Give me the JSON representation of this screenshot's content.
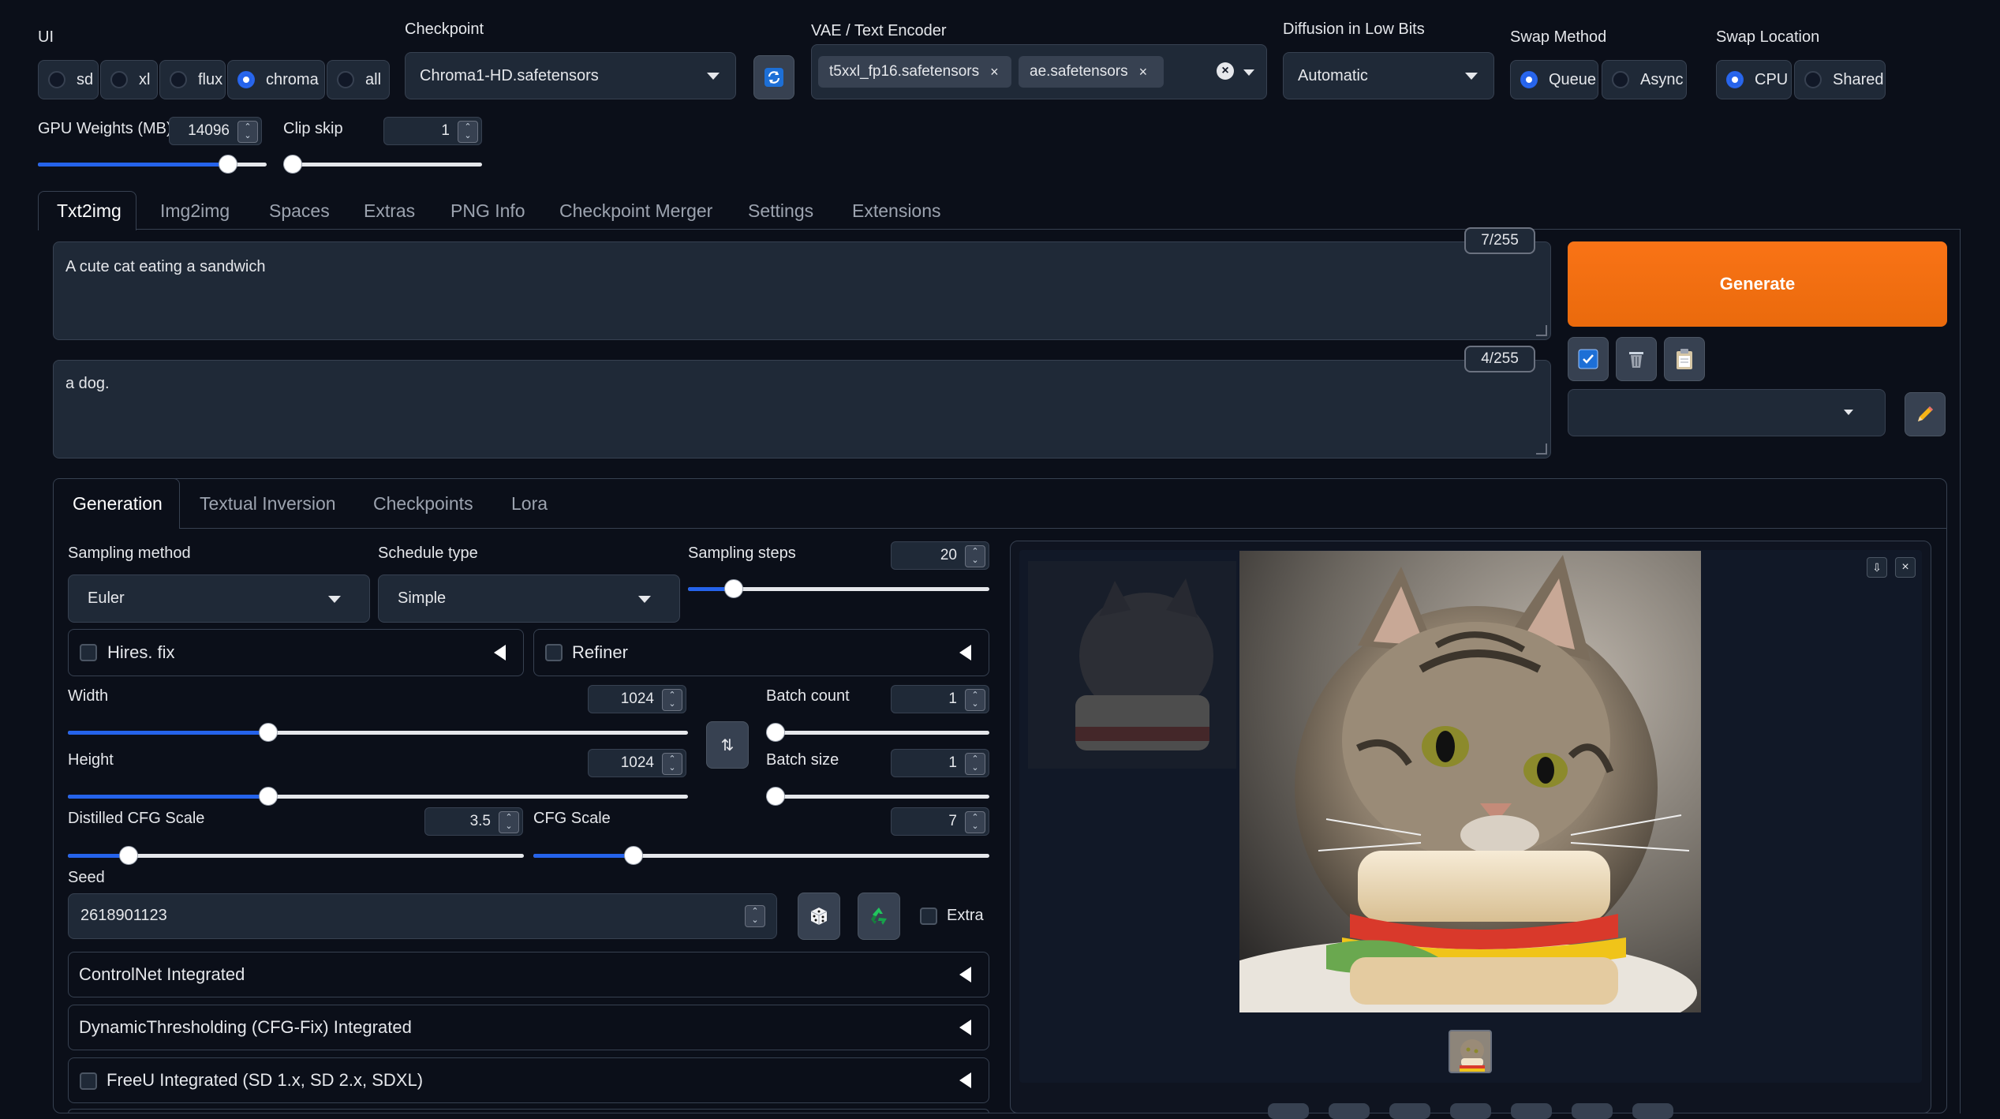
{
  "top": {
    "ui": {
      "label": "UI",
      "options": [
        "sd",
        "xl",
        "flux",
        "chroma",
        "all"
      ],
      "selected": "chroma"
    },
    "checkpoint": {
      "label": "Checkpoint",
      "value": "Chroma1-HD.safetensors"
    },
    "vae": {
      "label": "VAE / Text Encoder",
      "chips": [
        "t5xxl_fp16.safetensors",
        "ae.safetensors"
      ]
    },
    "lowbits": {
      "label": "Diffusion in Low Bits",
      "value": "Automatic"
    },
    "swap_method": {
      "label": "Swap Method",
      "options": [
        "Queue",
        "Async"
      ],
      "selected": "Queue"
    },
    "swap_location": {
      "label": "Swap Location",
      "options": [
        "CPU",
        "Shared"
      ],
      "selected": "CPU"
    },
    "gpu_weights": {
      "label": "GPU Weights (MB)",
      "value": "14096"
    },
    "clip_skip": {
      "label": "Clip skip",
      "value": "1"
    }
  },
  "main_tabs": [
    "Txt2img",
    "Img2img",
    "Spaces",
    "Extras",
    "PNG Info",
    "Checkpoint Merger",
    "Settings",
    "Extensions"
  ],
  "prompt": {
    "text": "A cute cat eating a sandwich",
    "counter": "7/255"
  },
  "negative": {
    "text": "a dog.",
    "counter": "4/255"
  },
  "generate_label": "Generate",
  "sub_tabs": [
    "Generation",
    "Textual Inversion",
    "Checkpoints",
    "Lora"
  ],
  "generation": {
    "sampling_method": {
      "label": "Sampling method",
      "value": "Euler"
    },
    "schedule_type": {
      "label": "Schedule type",
      "value": "Simple"
    },
    "sampling_steps": {
      "label": "Sampling steps",
      "value": "20"
    },
    "hires": "Hires. fix",
    "refiner": "Refiner",
    "width": {
      "label": "Width",
      "value": "1024"
    },
    "height": {
      "label": "Height",
      "value": "1024"
    },
    "batch_count": {
      "label": "Batch count",
      "value": "1"
    },
    "batch_size": {
      "label": "Batch size",
      "value": "1"
    },
    "distilled_cfg": {
      "label": "Distilled CFG Scale",
      "value": "3.5"
    },
    "cfg": {
      "label": "CFG Scale",
      "value": "7"
    },
    "seed": {
      "label": "Seed",
      "value": "2618901123"
    },
    "extra": "Extra",
    "accordions": [
      "ControlNet Integrated",
      "DynamicThresholding (CFG-Fix) Integrated",
      "FreeU Integrated (SD 1.x, SD 2.x, SDXL)"
    ]
  },
  "colors": {
    "background": "#0b0f19",
    "panel": "#1f2937",
    "accent": "#2563eb",
    "generate": "#f97316"
  }
}
